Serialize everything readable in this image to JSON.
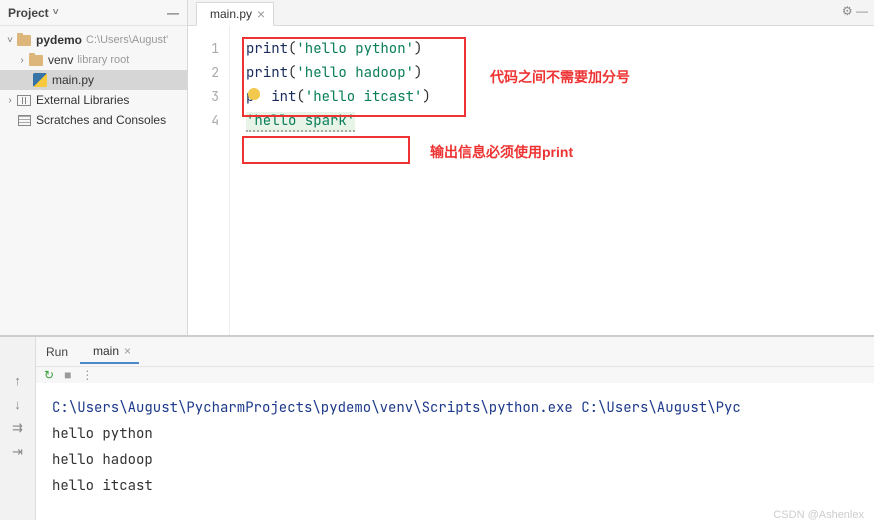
{
  "sidebar": {
    "title": "Project",
    "items": [
      {
        "label": "pydemo",
        "hint": "C:\\Users\\August'"
      },
      {
        "label": "venv",
        "hint": "library root"
      },
      {
        "label": "main.py"
      },
      {
        "label": "External Libraries"
      },
      {
        "label": "Scratches and Consoles"
      }
    ]
  },
  "editor": {
    "tab": "main.py",
    "lines": {
      "l1_fn": "print",
      "l1_str": "'hello python'",
      "l2_fn": "print",
      "l2_str": "'hello hadoop'",
      "l3_fn": "  int",
      "l3_pre": "p",
      "l3_str": "'hello itcast'",
      "l4_str": "'hello spark'"
    },
    "gutter": [
      "1",
      "2",
      "3",
      "4"
    ]
  },
  "annotations": {
    "a1": "代码之间不需要加分号",
    "a2": "输出信息必须使用print"
  },
  "run": {
    "label": "Run",
    "tab": "main",
    "command": "C:\\Users\\August\\PycharmProjects\\pydemo\\venv\\Scripts\\python.exe C:\\Users\\August\\Pyc",
    "output": [
      "hello python",
      "hello hadoop",
      "hello itcast"
    ]
  },
  "watermark": "CSDN @Ashenlex"
}
